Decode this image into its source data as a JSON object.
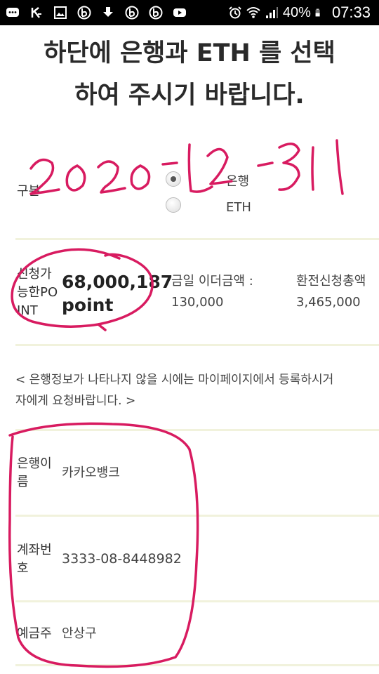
{
  "statusbar": {
    "battery_percent": "40%",
    "time": "07:33",
    "icons": [
      "message-icon",
      "k-icon",
      "image-icon",
      "b-app-icon",
      "download-icon",
      "b-app-icon",
      "b-app-icon",
      "youtube-icon",
      "alarm-icon",
      "wifi-icon",
      "signal-icon",
      "battery-icon"
    ]
  },
  "headline": {
    "line1": "하단에 은행과 ETH 를 선택",
    "line2": "하여 주시기 바랍니다."
  },
  "handwriting": {
    "date": "2020-12-31"
  },
  "category": {
    "label": "구분",
    "options": [
      {
        "label": "은행",
        "selected": true
      },
      {
        "label": "ETH",
        "selected": false
      }
    ]
  },
  "points": {
    "label": "신청가능한POINT",
    "amount": "68,000,187",
    "unit": "point",
    "eth_today_label": "금일 이더금액 :",
    "eth_today_value": "130,000",
    "exchange_total_label": "환전신청총액",
    "exchange_total_value": "3,465,000"
  },
  "notice": {
    "line1": "< 은행정보가 나타나지 않을 시에는 마이페이지에서 등록하시거",
    "line2": "자에게 요청바랍니다. >"
  },
  "bank": {
    "bank_name_label": "은행이름",
    "bank_name_value": "카카오뱅크",
    "account_label": "계좌번호",
    "account_value": "3333-08-8448982",
    "holder_label": "예금주",
    "holder_value": "안상구"
  },
  "colors": {
    "annotation": "#d81b60",
    "divider": "#f1f2dc",
    "statusbar": "#000000"
  }
}
